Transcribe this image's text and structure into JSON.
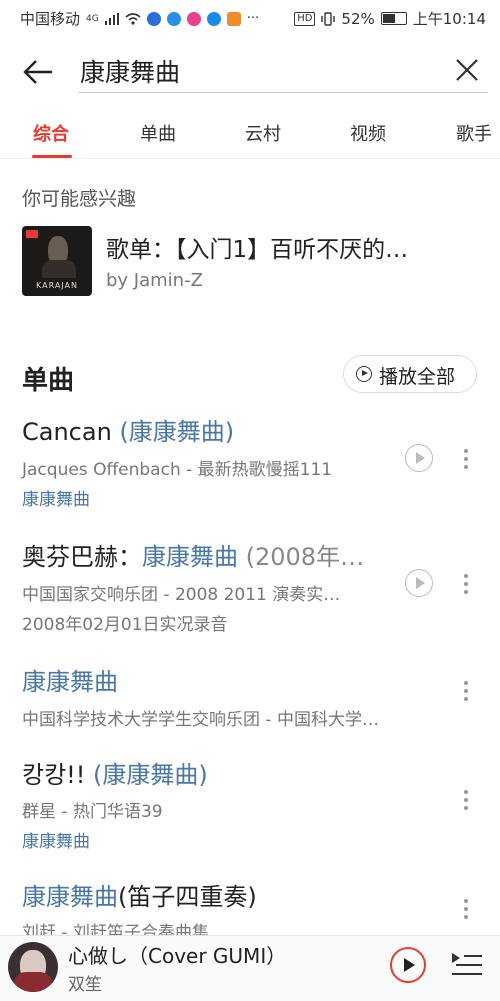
{
  "status_bar": {
    "carrier": "中国移动",
    "network": "4G",
    "battery": "52%",
    "time": "上午10:14"
  },
  "search": {
    "query": "康康舞曲"
  },
  "tabs": [
    "综合",
    "单曲",
    "云村",
    "视频",
    "歌手"
  ],
  "suggestion": {
    "title": "你可能感兴趣",
    "playlist_title": "歌单：【入门1】百听不厌的…",
    "playlist_by": "by Jamin-Z",
    "cover_text": "KARAJAN"
  },
  "section": {
    "title": "单曲",
    "play_all": "播放全部"
  },
  "songs": [
    {
      "name": "Cancan ",
      "paren": "(康康舞曲)",
      "meta": "Jacques Offenbach - 最新热歌慢摇111",
      "tag": "康康舞曲"
    },
    {
      "name": "奥芬巴赫：",
      "highlight": "康康舞曲",
      "rest": " (2008年…",
      "meta": "中国国家交响乐团 - 2008 2011 演奏实…",
      "extra": "2008年02月01日实况录音"
    },
    {
      "highlight": "康康舞曲",
      "meta": "中国科学技术大学学生交响乐团 - 中国科大学…"
    },
    {
      "name": "캉캉!! ",
      "paren": "(康康舞曲)",
      "meta": "群星 - 热门华语39",
      "tag": "康康舞曲"
    },
    {
      "highlight": "康康舞曲",
      "rest": "(笛子四重奏)",
      "meta": "刘赶 - 刘赶笛子合奏曲集"
    }
  ],
  "player": {
    "title": "心做し（Cover GUMI）",
    "artist": "双笙"
  }
}
